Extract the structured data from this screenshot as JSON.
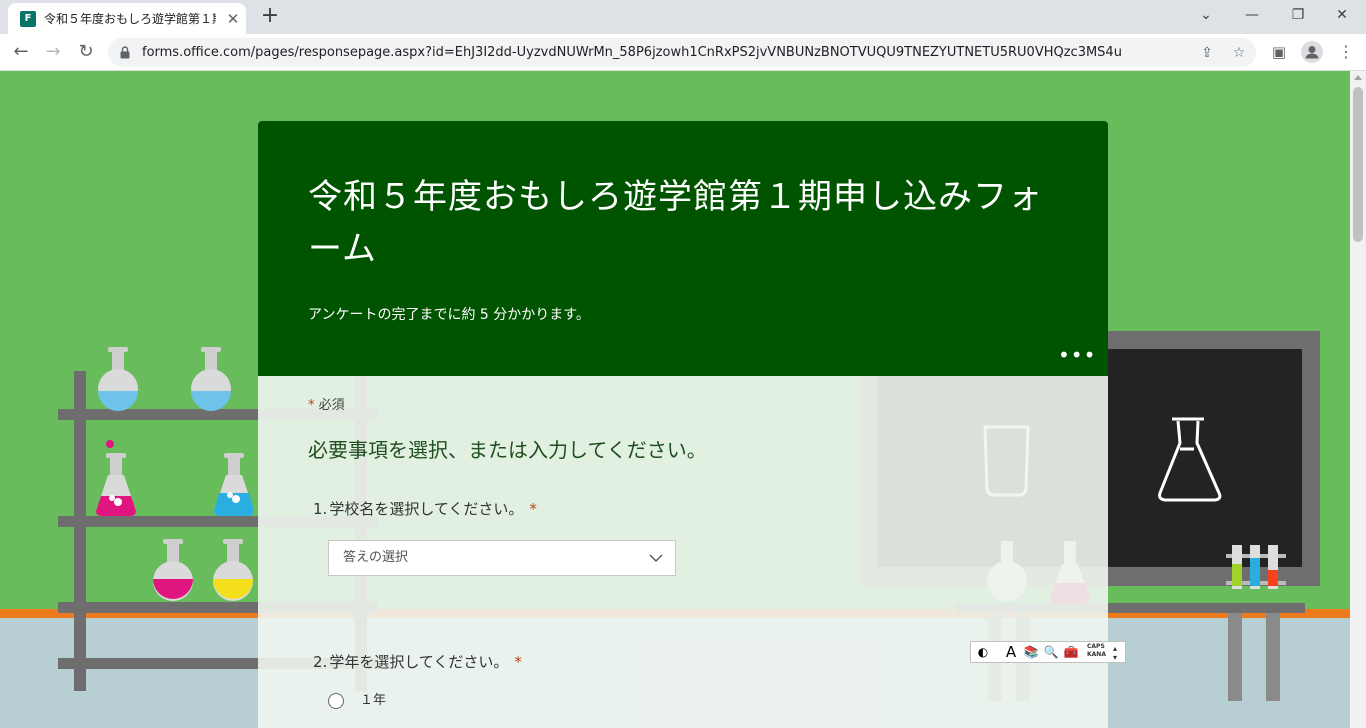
{
  "browser": {
    "tab_title": "令和５年度おもしろ遊学館第１期申し込みフォーム",
    "tab_icon": "forms-icon",
    "tab_favicon_letter": "F",
    "new_tab_symbol": "+",
    "url": "forms.office.com/pages/responsepage.aspx?id=EhJ3I2dd-UyzvdNUWrMn_58P6jzowh1CnRxPS2jvVNBUNzBNOTVUQU9TNEZYUTNETU5RU0VHQzc3MS4u"
  },
  "form": {
    "title": "令和５年度おもしろ遊学館第１期申し込みフォーム",
    "subtitle": "アンケートの完了までに約 5 分かかります。",
    "required_star": "*",
    "required_note": "必須",
    "instruction": "必要事項を選択、または入力してください。",
    "questions": [
      {
        "number": "1.",
        "label": "学校名を選択してください。",
        "required_mark": "*",
        "dropdown_value": "答えの選択"
      },
      {
        "number": "2.",
        "label": "学年を選択してください。",
        "required_mark": "*",
        "options": [
          "１年"
        ]
      }
    ]
  },
  "ime": {
    "caps_label": "CAPS",
    "kana_label": "KANA",
    "mode_letter": "A"
  },
  "colors": {
    "header_green": "#005400",
    "background_green": "#68bc5c",
    "required_red": "#c43e1c"
  }
}
